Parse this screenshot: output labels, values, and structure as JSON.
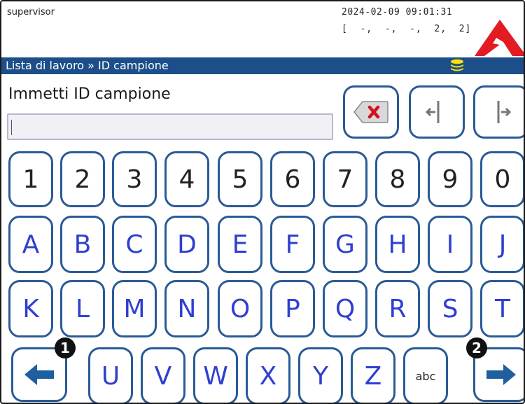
{
  "header": {
    "user": "supervisor",
    "datetime": "2024-02-09 09:01:31",
    "status": "[  -,  -,  -,  2,  2]"
  },
  "breadcrumb": "Lista di lavoro » ID campione",
  "prompt": "Immetti ID campione",
  "input": {
    "value": ""
  },
  "keys": {
    "backspace_icon": "backspace-x-icon",
    "cursor_left_icon": "cursor-left-icon",
    "cursor_right_icon": "cursor-right-icon",
    "row1": [
      "1",
      "2",
      "3",
      "4",
      "5",
      "6",
      "7",
      "8",
      "9",
      "0"
    ],
    "row2": [
      "A",
      "B",
      "C",
      "D",
      "E",
      "F",
      "G",
      "H",
      "I",
      "J"
    ],
    "row3": [
      "K",
      "L",
      "M",
      "N",
      "O",
      "P",
      "Q",
      "R",
      "S",
      "T"
    ],
    "row4": [
      "U",
      "V",
      "W",
      "X",
      "Y",
      "Z",
      "abc"
    ]
  },
  "markers": {
    "left": "1",
    "right": "2"
  },
  "colors": {
    "breadcrumb_bg": "#1c4f8a",
    "key_border": "#2a5b95",
    "letter_text": "#2f3fd0",
    "logo_red": "#e31b23",
    "db_icon": "#ffe100",
    "backspace_x": "#d4121c"
  }
}
